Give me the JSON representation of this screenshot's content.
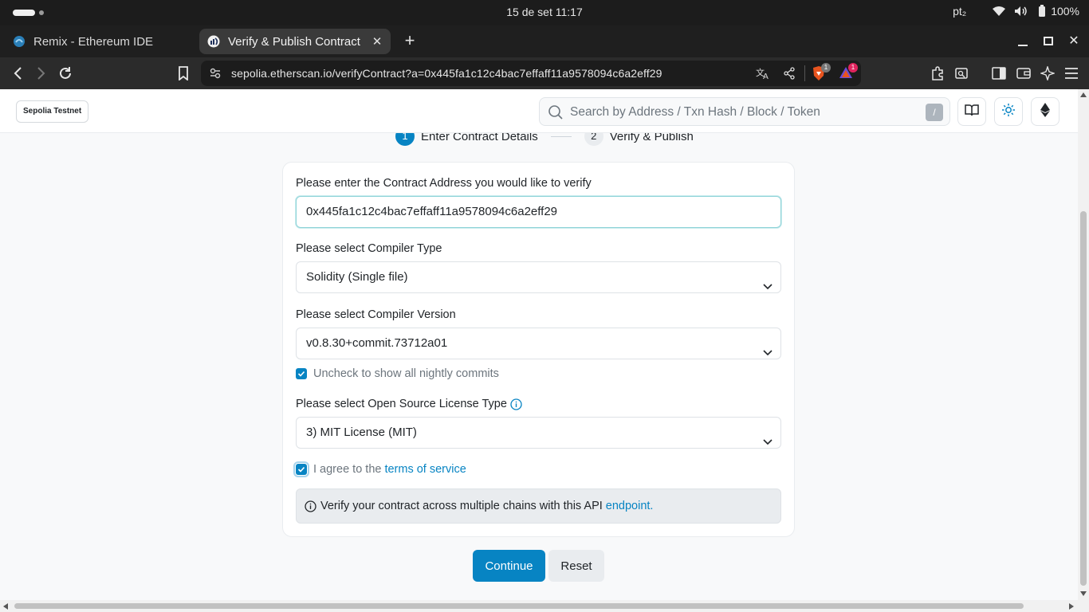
{
  "os": {
    "datetime": "15 de set  11:17",
    "keyboard": "pt₂",
    "battery": "100%"
  },
  "browser": {
    "tabs": [
      {
        "title": "Remix - Ethereum IDE",
        "favicon": "remix-icon"
      },
      {
        "title": "Verify & Publish Contract",
        "favicon": "etherscan-icon"
      }
    ],
    "url": "sepolia.etherscan.io/verifyContract?a=0x445fa1c12c4bac7effaff11a9578094c6a2eff29",
    "brave_shield_count": "1",
    "rewards_count": "1"
  },
  "header": {
    "network": "Sepolia Testnet",
    "search_placeholder": "Search by Address / Txn Hash / Block / Token",
    "search_shortcut": "/"
  },
  "stepper": [
    {
      "number": "1",
      "label": "Enter Contract Details"
    },
    {
      "number": "2",
      "label": "Verify & Publish"
    }
  ],
  "form": {
    "address_label": "Please enter the Contract Address you would like to verify",
    "address_value": "0x445fa1c12c4bac7effaff11a9578094c6a2eff29",
    "compiler_type_label": "Please select Compiler Type",
    "compiler_type_value": "Solidity (Single file)",
    "compiler_version_label": "Please select Compiler Version",
    "compiler_version_value": "v0.8.30+commit.73712a01",
    "nightly_label": "Uncheck to show all nightly commits",
    "license_label": "Please select Open Source License Type",
    "license_value": "3) MIT License (MIT)",
    "agree_prefix": "I agree to the",
    "agree_link": "terms of service",
    "info_text": "Verify your contract across multiple chains with this API",
    "info_link": "endpoint."
  },
  "buttons": {
    "continue": "Continue",
    "reset": "Reset"
  },
  "colors": {
    "primary": "#0784c3",
    "os_bar": "#1c1c1c",
    "page_bg": "#f8f9fa"
  }
}
